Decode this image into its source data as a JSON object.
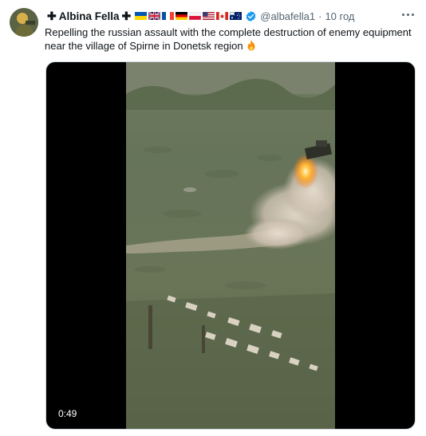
{
  "author": {
    "display_name": "Albina Fella",
    "prefix_symbol": "✚",
    "suffix_symbol": "✚",
    "handle": "@albafella1",
    "separator": "·",
    "timestamp": "10 год",
    "verified": true,
    "flags": [
      "ukraine-flag",
      "uk-flag",
      "france-flag",
      "germany-flag",
      "poland-flag",
      "usa-flag",
      "canada-flag",
      "australia-flag"
    ]
  },
  "tweet": {
    "text": "Repelling the russian assault with the complete destruction of enemy equipment near the village of Spirne in Donetsk region",
    "emoji": "fire-icon"
  },
  "media": {
    "type": "video",
    "duration": "0:49"
  },
  "icons": {
    "more": "more-options-icon",
    "verified": "verified-badge-icon"
  },
  "colors": {
    "text": "#0f1419",
    "secondary": "#536471",
    "verified": "#1d9bf0"
  }
}
